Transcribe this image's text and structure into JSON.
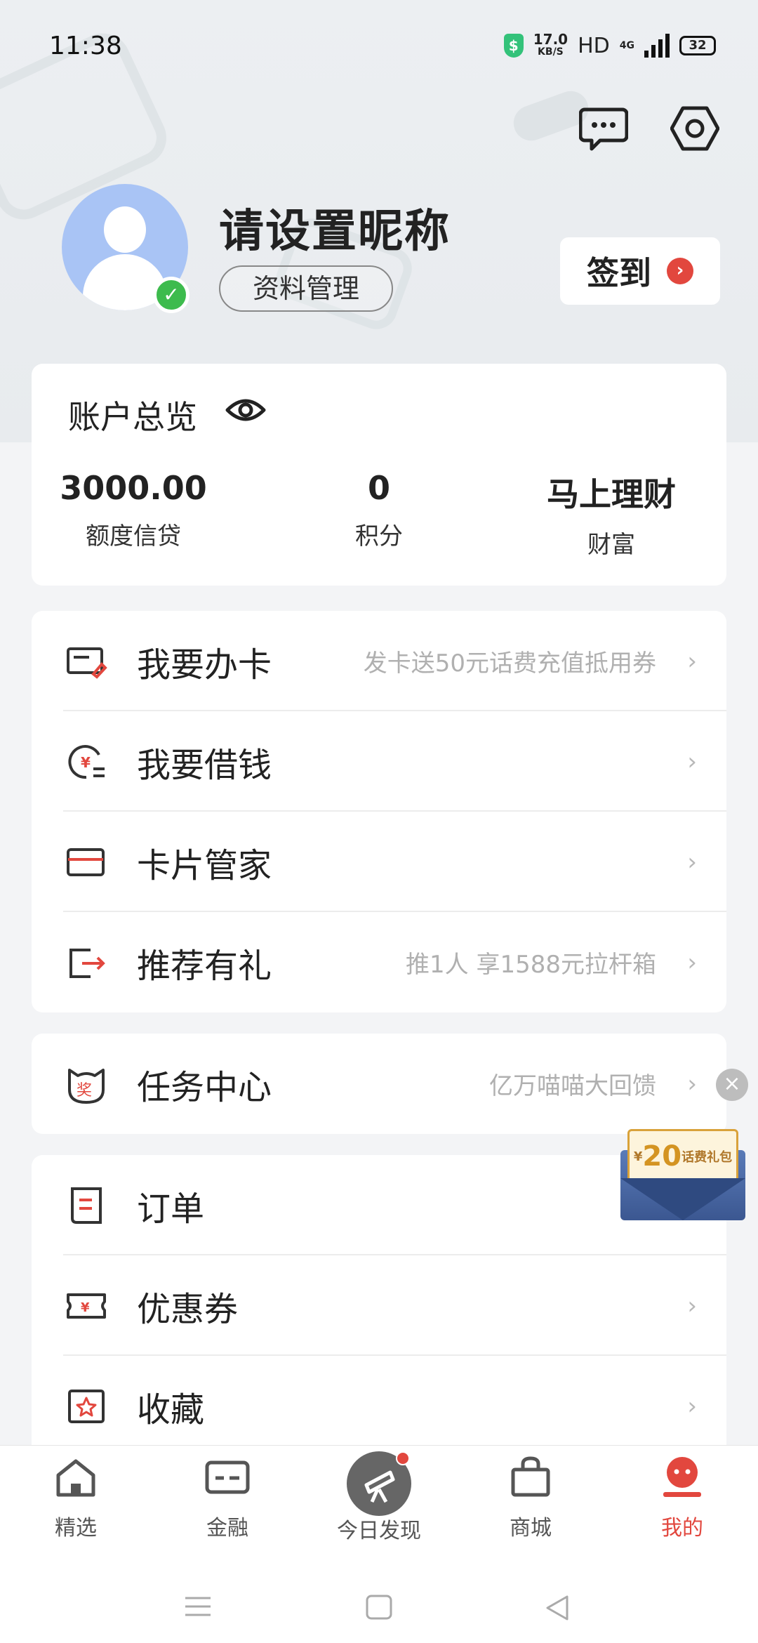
{
  "status_bar": {
    "time": "11:38",
    "net_speed_value": "17.0",
    "net_speed_unit": "KB/S",
    "hd": "HD",
    "network": "4G",
    "battery": "32"
  },
  "profile": {
    "nickname": "请设置昵称",
    "manage_label": "资料管理",
    "checkin_label": "签到"
  },
  "overview": {
    "title": "账户总览",
    "stats": [
      {
        "value": "3000.00",
        "label": "额度信贷"
      },
      {
        "value": "0",
        "label": "积分"
      },
      {
        "value": "马上理财",
        "label": "财富"
      }
    ]
  },
  "menu_group1": [
    {
      "label": "我要办卡",
      "hint": "发卡送50元话费充值抵用券",
      "icon": "card-apply-icon"
    },
    {
      "label": "我要借钱",
      "hint": "",
      "icon": "borrow-money-icon"
    },
    {
      "label": "卡片管家",
      "hint": "",
      "icon": "card-manager-icon"
    },
    {
      "label": "推荐有礼",
      "hint": "推1人 享1588元拉杆箱",
      "icon": "referral-icon"
    }
  ],
  "task_center": {
    "label": "任务中心",
    "hint": "亿万喵喵大回馈",
    "badge": "奖"
  },
  "menu_group2": [
    {
      "label": "订单",
      "icon": "order-icon"
    },
    {
      "label": "优惠券",
      "icon": "coupon-icon"
    },
    {
      "label": "收藏",
      "icon": "favorite-icon"
    }
  ],
  "gift_float": {
    "currency": "¥",
    "amount": "20",
    "text": "话费礼包"
  },
  "bottom_nav": [
    {
      "label": "精选",
      "icon": "home-icon"
    },
    {
      "label": "金融",
      "icon": "finance-icon"
    },
    {
      "label": "今日发现",
      "icon": "telescope-icon"
    },
    {
      "label": "商城",
      "icon": "shopping-bag-icon"
    },
    {
      "label": "我的",
      "icon": "profile-icon"
    }
  ],
  "colors": {
    "accent": "#e2473e",
    "verified": "#3dbb4d",
    "avatar_bg": "#a9c4f5"
  }
}
